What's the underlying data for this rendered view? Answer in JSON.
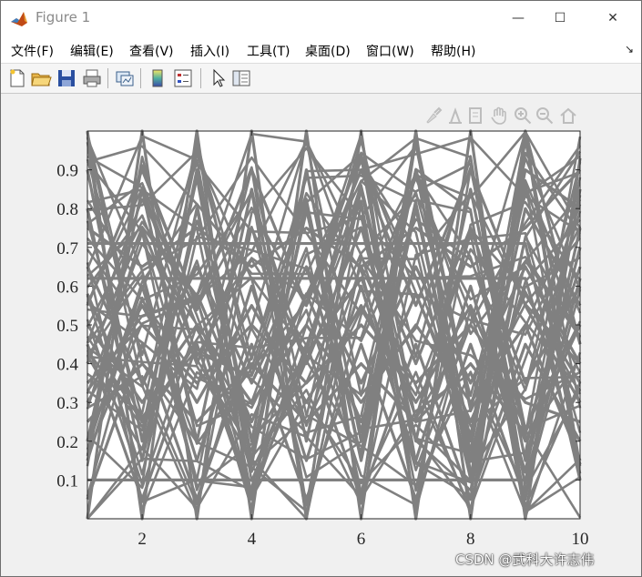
{
  "window": {
    "title": "Figure 1",
    "controls": {
      "minimize": "—",
      "maximize": "☐",
      "close": "✕"
    }
  },
  "menu": {
    "items": [
      {
        "label": "文件(F)"
      },
      {
        "label": "编辑(E)"
      },
      {
        "label": "查看(V)"
      },
      {
        "label": "插入(I)"
      },
      {
        "label": "工具(T)"
      },
      {
        "label": "桌面(D)"
      },
      {
        "label": "窗口(W)"
      },
      {
        "label": "帮助(H)"
      }
    ],
    "dock_glyph": "↘"
  },
  "toolbar": {
    "icons": [
      "new-figure-icon",
      "open-folder-icon",
      "save-icon",
      "print-icon",
      "link-plot-icon",
      "colorbar-icon",
      "legend-icon",
      "pointer-icon",
      "property-editor-icon"
    ]
  },
  "axes_toolbar": {
    "icons": [
      "brush-icon",
      "data-tip-icon",
      "rotate-icon",
      "pan-icon",
      "zoom-in-icon",
      "zoom-out-icon",
      "home-icon"
    ]
  },
  "chart_data": {
    "type": "line",
    "title": "",
    "xlabel": "",
    "ylabel": "",
    "xlim": [
      1,
      10
    ],
    "ylim": [
      0,
      1
    ],
    "xticks": [
      2,
      4,
      6,
      8,
      10
    ],
    "yticks": [
      0.1,
      0.2,
      0.3,
      0.4,
      0.5,
      0.6,
      0.7,
      0.8,
      0.9
    ],
    "xtick_labels": [
      "2",
      "4",
      "6",
      "8",
      "10"
    ],
    "ytick_labels": [
      "0.1",
      "0.2",
      "0.3",
      "0.4",
      "0.5",
      "0.6",
      "0.7",
      "0.8",
      "0.9"
    ],
    "line_color": "#808080",
    "grid": false,
    "legend": "none",
    "x": [
      1,
      2,
      3,
      4,
      5,
      6,
      7,
      8,
      9,
      10
    ],
    "series": [
      {
        "values": [
          1.0,
          0.0,
          1.0,
          0.0,
          1.0,
          0.0,
          1.0,
          0.0,
          1.0,
          0.45
        ]
      },
      {
        "values": [
          0.0,
          1.0,
          0.0,
          1.0,
          0.0,
          1.0,
          0.0,
          1.0,
          0.0,
          0.93
        ]
      },
      {
        "values": [
          0.71,
          0.71,
          0.71,
          0.71,
          0.71,
          0.71,
          0.71,
          0.71,
          0.71,
          0.1
        ]
      },
      {
        "values": [
          0.1,
          0.1,
          0.1,
          0.1,
          0.1,
          0.1,
          0.1,
          0.1,
          0.1,
          0.62
        ]
      },
      {
        "values": [
          0.62,
          0.62,
          0.62,
          0.62,
          0.62,
          0.62,
          0.62,
          0.62,
          0.62,
          0.14
        ]
      },
      {
        "values": [
          0.55,
          0.9,
          0.55,
          0.9,
          0.55,
          0.9,
          0.55,
          0.9,
          0.55,
          0.3
        ]
      },
      {
        "values": [
          0.9,
          0.2,
          0.9,
          0.2,
          0.9,
          0.2,
          0.9,
          0.2,
          0.9,
          0.8
        ]
      },
      {
        "values": [
          0.3,
          0.55,
          0.3,
          0.55,
          0.3,
          0.55,
          0.3,
          0.55,
          0.2,
          0.5
        ]
      },
      {
        "values": [
          0.45,
          0.05,
          0.45,
          0.05,
          0.45,
          0.05,
          0.45,
          0.05,
          0.45,
          0.2
        ]
      },
      {
        "values": [
          0.2,
          0.85,
          0.2,
          0.85,
          0.2,
          0.85,
          0.2,
          0.85,
          0.15,
          0.7
        ]
      },
      {
        "values": [
          0.65,
          0.35,
          0.65,
          0.35,
          0.65,
          0.35,
          0.65,
          0.35,
          0.65,
          0.4
        ]
      },
      {
        "values": [
          0.05,
          0.45,
          0.05,
          0.45,
          0.05,
          0.45,
          0.05,
          0.45,
          0.05,
          0.85
        ]
      },
      {
        "values": [
          0.8,
          0.15,
          0.8,
          0.15,
          0.8,
          0.15,
          0.8,
          0.15,
          0.8,
          0.55
        ]
      },
      {
        "values": [
          0.4,
          0.75,
          0.4,
          0.75,
          0.4,
          0.75,
          0.4,
          0.75,
          0.35,
          0.6
        ]
      },
      {
        "values": [
          0.15,
          0.6,
          0.15,
          0.6,
          0.15,
          0.6,
          0.15,
          0.6,
          0.12,
          0.75
        ]
      },
      {
        "values": [
          0.58,
          0.25,
          0.58,
          0.25,
          0.58,
          0.25,
          0.58,
          0.25,
          0.58,
          0.35
        ]
      },
      {
        "values": [
          0.35,
          0.5,
          0.35,
          0.5,
          0.35,
          0.5,
          0.35,
          0.5,
          0.3,
          0.25
        ]
      },
      {
        "values": [
          0.25,
          0.4,
          0.25,
          0.4,
          0.25,
          0.4,
          0.25,
          0.4,
          0.22,
          0.65
        ]
      },
      {
        "values": [
          0.5,
          0.3,
          0.5,
          0.3,
          0.5,
          0.3,
          0.5,
          0.3,
          0.5,
          0.15
        ]
      },
      {
        "values": [
          0.75,
          0.65,
          0.75,
          0.65,
          0.75,
          0.65,
          0.75,
          0.65,
          0.75,
          0.9
        ]
      }
    ]
  },
  "watermark": "CSDN @武科大许志伟"
}
